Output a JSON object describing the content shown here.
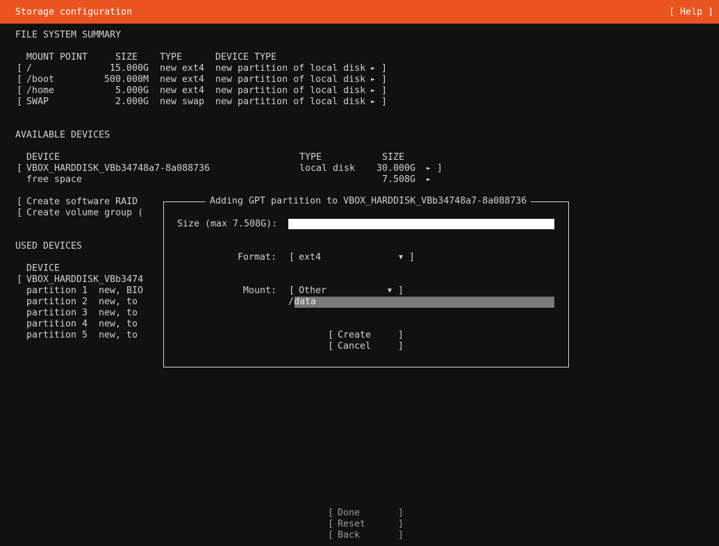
{
  "header": {
    "title": "Storage configuration",
    "help": "[ Help ]"
  },
  "fs_summary": {
    "heading": "FILE SYSTEM SUMMARY",
    "columns": {
      "mount": "MOUNT POINT",
      "size": "SIZE",
      "type": "TYPE",
      "device_type": "DEVICE TYPE"
    },
    "rows": [
      {
        "mount": "/",
        "size": "15.000G",
        "type": "new ext4",
        "device_type": "new partition of local disk"
      },
      {
        "mount": "/boot",
        "size": "500.000M",
        "type": "new ext4",
        "device_type": "new partition of local disk"
      },
      {
        "mount": "/home",
        "size": "5.000G",
        "type": "new ext4",
        "device_type": "new partition of local disk"
      },
      {
        "mount": "SWAP",
        "size": "2.000G",
        "type": "new swap",
        "device_type": "new partition of local disk"
      }
    ]
  },
  "available": {
    "heading": "AVAILABLE DEVICES",
    "columns": {
      "device": "DEVICE",
      "type": "TYPE",
      "size": "SIZE"
    },
    "disk": {
      "device": "VBOX_HARDDISK_VBb34748a7-8a088736",
      "type": "local disk",
      "size": "30.000G"
    },
    "free": {
      "device": "free space",
      "size": "7.508G"
    },
    "actions": [
      "Create software RAID",
      "Create volume group ("
    ]
  },
  "used": {
    "heading": "USED DEVICES",
    "column": "DEVICE",
    "disk": "VBOX_HARDDISK_VBb3474",
    "partitions": [
      {
        "name": "partition 1",
        "desc": "new, BIO"
      },
      {
        "name": "partition 2",
        "desc": "new, to"
      },
      {
        "name": "partition 3",
        "desc": "new, to"
      },
      {
        "name": "partition 4",
        "desc": "new, to"
      },
      {
        "name": "partition 5",
        "desc": "new, to"
      }
    ]
  },
  "dialog": {
    "title": "Adding GPT partition to VBOX_HARDDISK_VBb34748a7-8a088736",
    "size_label": "Size (max 7.508G):",
    "size_value": "",
    "format_label": "Format:",
    "format_value": "ext4",
    "mount_label": "Mount:",
    "mount_value": "Other",
    "mount_slash": "/",
    "mount_path": "data",
    "create_label": "Create",
    "cancel_label": "Cancel"
  },
  "footer": {
    "done": "Done",
    "reset": "Reset",
    "back": "Back"
  },
  "glyphs": {
    "open": "[",
    "close": "]",
    "arrow": "►",
    "dropdown": "▼"
  }
}
